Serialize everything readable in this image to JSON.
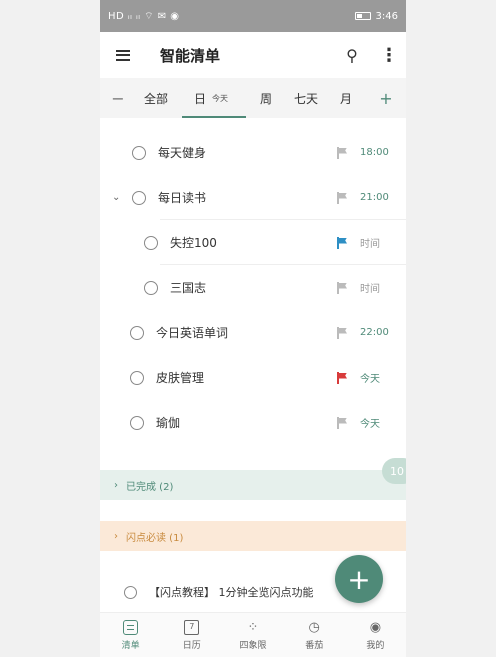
{
  "statusbar": {
    "left": "HD ᵢₗ ᵢₗ ⌔ ✉ ◉",
    "time": "3:46"
  },
  "appbar": {
    "title": "智能清单"
  },
  "tabs": {
    "all": "全部",
    "day": "日",
    "day_sub": "今天",
    "week": "周",
    "seven": "七天",
    "month": "月"
  },
  "tasks": [
    {
      "label": "每天健身",
      "time": "18:00",
      "time_style": "green",
      "flag": "grey"
    },
    {
      "label": "每日读书",
      "time": "21:00",
      "time_style": "green",
      "flag": "grey",
      "expanded": true
    },
    {
      "label": "失控100",
      "time": "时间",
      "time_style": "grey",
      "flag": "blue",
      "indent": true
    },
    {
      "label": "三国志",
      "time": "时间",
      "time_style": "grey",
      "flag": "grey",
      "indent": true
    },
    {
      "label": "今日英语单词",
      "time": "22:00",
      "time_style": "green",
      "flag": "grey"
    },
    {
      "label": "皮肤管理",
      "time": "今天",
      "time_style": "green",
      "flag": "red"
    },
    {
      "label": "瑜伽",
      "time": "今天",
      "time_style": "green",
      "flag": "grey"
    }
  ],
  "groups": {
    "done": "已完成 (2)",
    "flash": "闪点必读 (1)"
  },
  "badge": "10",
  "bottom_task": {
    "label": "【闪点教程】 1分钟全览闪点功能"
  },
  "nav": {
    "list": "清单",
    "calendar": "日历",
    "quadrant": "四象限",
    "pomodoro": "番茄",
    "me": "我的"
  },
  "colors": {
    "accent": "#4f8a78",
    "flag_blue": "#2e8fc4",
    "flag_red": "#d83b3b"
  }
}
